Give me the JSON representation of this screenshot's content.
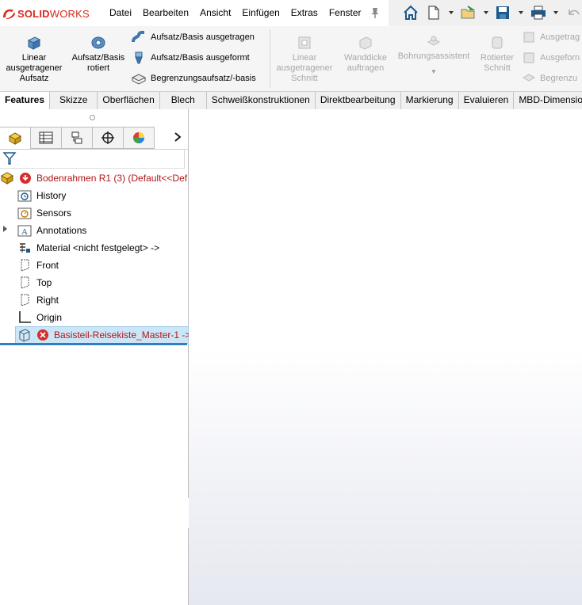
{
  "app": {
    "logo_bold": "SOLID",
    "logo_light": "WORKS",
    "brand_color": "#da291c"
  },
  "menu": [
    "Datei",
    "Bearbeiten",
    "Ansicht",
    "Einfügen",
    "Extras",
    "Fenster"
  ],
  "quick_access_icons": [
    "home-icon",
    "new-document-icon",
    "open-icon",
    "save-icon",
    "print-icon",
    "undo-icon"
  ],
  "ribbon": {
    "extruded_boss": "Linear ausgetragener Aufsatz",
    "revolved_boss": "Aufsatz/Basis rotiert",
    "swept_boss": "Aufsatz/Basis ausgetragen",
    "lofted_boss": "Aufsatz/Basis ausgeformt",
    "boundary_boss": "Begrenzungsaufsatz/-basis",
    "extruded_cut": "Linear ausgetragener Schnitt",
    "shell": "Wanddicke auftragen",
    "hole_wizard": "Bohrungsassistent",
    "revolved_cut": "Rotierter Schnitt",
    "swept_cut": "Ausgetrag",
    "lofted_cut": "Ausgeforn",
    "boundary_cut": "Begrenzu"
  },
  "tabs": [
    "Features",
    "Skizze",
    "Oberflächen",
    "Blech",
    "Schweißkonstruktionen",
    "Direktbearbeitung",
    "Markierung",
    "Evaluieren",
    "MBD-Dimensio"
  ],
  "tree": {
    "root": "Bodenrahmen R1 (3)  (Default<<Def",
    "history": "History",
    "sensors": "Sensors",
    "annotations": "Annotations",
    "material": "Material <nicht festgelegt> ->",
    "front": "Front",
    "top": "Top",
    "right": "Right",
    "origin": "Origin",
    "base_part": "Basisteil-Reisekiste_Master-1 ->"
  }
}
